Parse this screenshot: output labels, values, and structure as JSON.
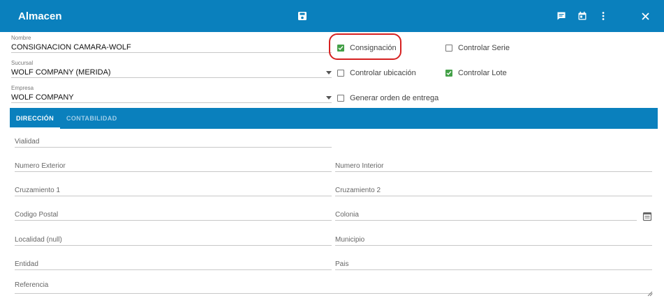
{
  "window": {
    "title": "Almacen",
    "icons": [
      "save-icon",
      "notes-icon",
      "calendar-icon",
      "more-vert-icon",
      "close-icon"
    ],
    "accent_color": "#0a80bd"
  },
  "form": {
    "nombre": {
      "label": "Nombre",
      "value": "CONSIGNACION CAMARA-WOLF"
    },
    "sucursal": {
      "label": "Sucursal",
      "value": "WOLF COMPANY (MERIDA)"
    },
    "empresa": {
      "label": "Empresa",
      "value": "WOLF COMPANY"
    }
  },
  "checks": {
    "consignacion": {
      "label": "Consignación",
      "checked": true
    },
    "controlar_serie": {
      "label": "Controlar Serie",
      "checked": false
    },
    "controlar_ubicacion": {
      "label": "Controlar ubicación",
      "checked": false
    },
    "controlar_lote": {
      "label": "Controlar Lote",
      "checked": true
    },
    "generar_orden": {
      "label": "Generar orden de entrega",
      "checked": false
    }
  },
  "tabs": [
    {
      "label": "DIRECCIÓN",
      "active": true
    },
    {
      "label": "CONTABILIDAD",
      "active": false
    }
  ],
  "address": {
    "vialidad": "Vialidad",
    "numero_exterior": "Numero Exterior",
    "numero_interior": "Numero Interior",
    "cruzamiento1": "Cruzamiento 1",
    "cruzamiento2": "Cruzamiento 2",
    "codigo_postal": "Codigo Postal",
    "colonia": "Colonia",
    "localidad": "Localidad (null)",
    "municipio": "Municipio",
    "entidad": "Entidad",
    "pais": "Pais",
    "referencia": "Referencia"
  }
}
